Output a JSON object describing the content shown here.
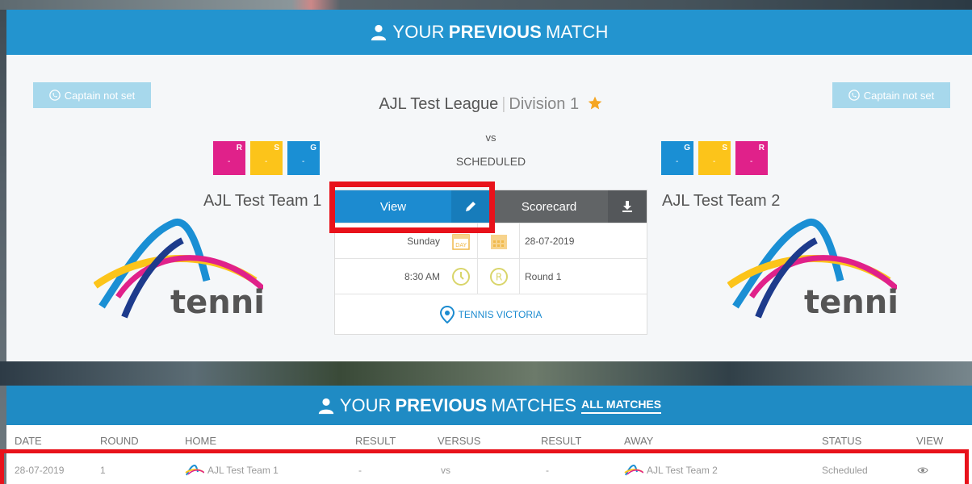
{
  "header": {
    "prefix": "YOUR",
    "bold": "PREVIOUS",
    "suffix": "MATCH"
  },
  "captain": {
    "left_label": "Captain not set",
    "right_label": "Captain not set"
  },
  "league": {
    "name": "AJL Test League",
    "separator": "|",
    "division": "Division 1"
  },
  "match": {
    "vs": "vs",
    "status": "SCHEDULED"
  },
  "rsg_left": [
    {
      "letter": "R",
      "value": "-",
      "color": "#e0218a"
    },
    {
      "letter": "S",
      "value": "-",
      "color": "#fcc41a"
    },
    {
      "letter": "G",
      "value": "-",
      "color": "#1a8fd4"
    }
  ],
  "rsg_right": [
    {
      "letter": "G",
      "value": "-",
      "color": "#1a8fd4"
    },
    {
      "letter": "S",
      "value": "-",
      "color": "#fcc41a"
    },
    {
      "letter": "R",
      "value": "-",
      "color": "#e0218a"
    }
  ],
  "teams": {
    "home": "AJL Test Team 1",
    "away": "AJL Test Team 2"
  },
  "logo_text": "tennis",
  "card": {
    "view_label": "View",
    "scorecard_label": "Scorecard",
    "day": "Sunday",
    "day_icon_text": "DAY",
    "date": "28-07-2019",
    "time": "8:30 AM",
    "round_icon_text": "R",
    "round": "Round 1",
    "venue": "TENNIS VICTORIA"
  },
  "matches": {
    "prefix": "YOUR",
    "bold": "PREVIOUS",
    "suffix": "MATCHES",
    "all_link": "ALL MATCHES",
    "columns": [
      "DATE",
      "ROUND",
      "HOME",
      "RESULT",
      "VERSUS",
      "RESULT",
      "AWAY",
      "STATUS",
      "VIEW"
    ],
    "rows": [
      {
        "date": "28-07-2019",
        "round": "1",
        "home": "AJL Test Team 1",
        "result_home": "-",
        "versus": "vs",
        "result_away": "-",
        "away": "AJL Test Team 2",
        "status": "Scheduled"
      }
    ]
  },
  "icons": [
    "user-icon",
    "phone-icon",
    "star-icon",
    "pencil-icon",
    "download-icon",
    "calendar-day-icon",
    "calendar-icon",
    "clock-icon",
    "round-icon",
    "location-pin-icon",
    "eye-icon"
  ],
  "colors": {
    "primary_blue": "#2394cf",
    "annotation_red": "#e8121b",
    "magenta": "#e0218a",
    "yellow": "#fcc41a",
    "captain_bg": "#a7d8ec"
  }
}
